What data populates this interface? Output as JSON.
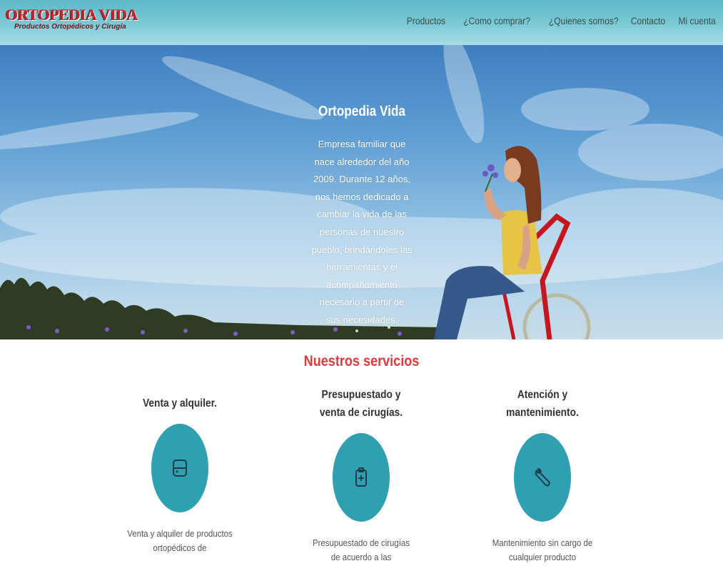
{
  "header": {
    "logo_title": "ORTOPEDIA VIDA",
    "logo_subtitle": "Productos Ortopédicos y Cirugía",
    "nav": [
      {
        "label": "Productos"
      },
      {
        "label": "¿Como comprar?"
      },
      {
        "label": "¿Quienes somos?"
      },
      {
        "label": "Contacto"
      },
      {
        "label": "Mi cuenta"
      }
    ]
  },
  "hero": {
    "title": "Ortopedia Vida",
    "description": "Empresa familiar que nace alrededor del año 2009. Durante 12 años, nos hemos dedicado a cambiar la vida de las personas de nuestro pueblo, brindándoles las herramientas y el acompañamiento necesario a partir de sus necesidades."
  },
  "services": {
    "title": "Nuestros servicios",
    "items": [
      {
        "title": "Venta y alquiler.",
        "icon": "calendar-card-icon",
        "description": "Venta y alquiler de productos ortopédicos de"
      },
      {
        "title": "Presupuestado y venta de cirugías.",
        "icon": "medical-clipboard-icon",
        "description": "Presupuestado de cirugías de acuerdo a las"
      },
      {
        "title": "Atención y mantenimiento.",
        "icon": "wrench-icon",
        "description": "Mantenimiento sin cargo de cualquier producto"
      }
    ]
  },
  "colors": {
    "header": "#7ccad6",
    "accent_red": "#e23a3a",
    "service_circle": "#2f9fb2"
  }
}
